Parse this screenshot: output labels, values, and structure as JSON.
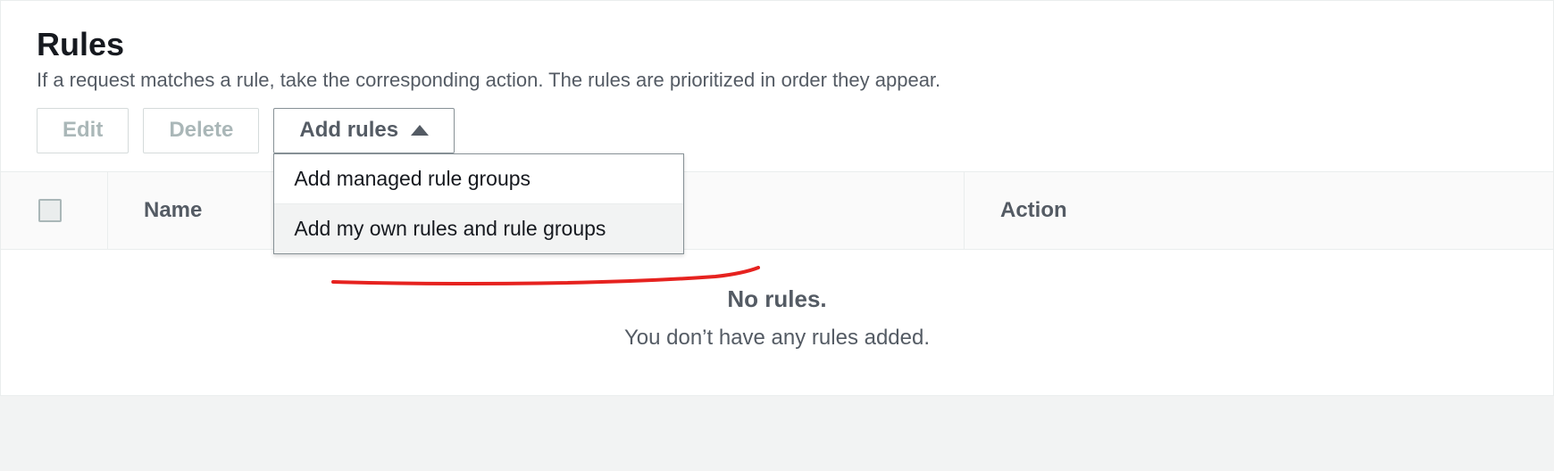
{
  "header": {
    "title": "Rules",
    "description": "If a request matches a rule, take the corresponding action. The rules are prioritized in order they appear."
  },
  "toolbar": {
    "edit_label": "Edit",
    "delete_label": "Delete",
    "add_rules_label": "Add rules"
  },
  "dropdown": {
    "items": [
      {
        "label": "Add managed rule groups"
      },
      {
        "label": "Add my own rules and rule groups"
      }
    ]
  },
  "table": {
    "columns": {
      "name": "Name",
      "action": "Action"
    },
    "empty": {
      "title": "No rules.",
      "subtitle": "You don’t have any rules added."
    }
  }
}
